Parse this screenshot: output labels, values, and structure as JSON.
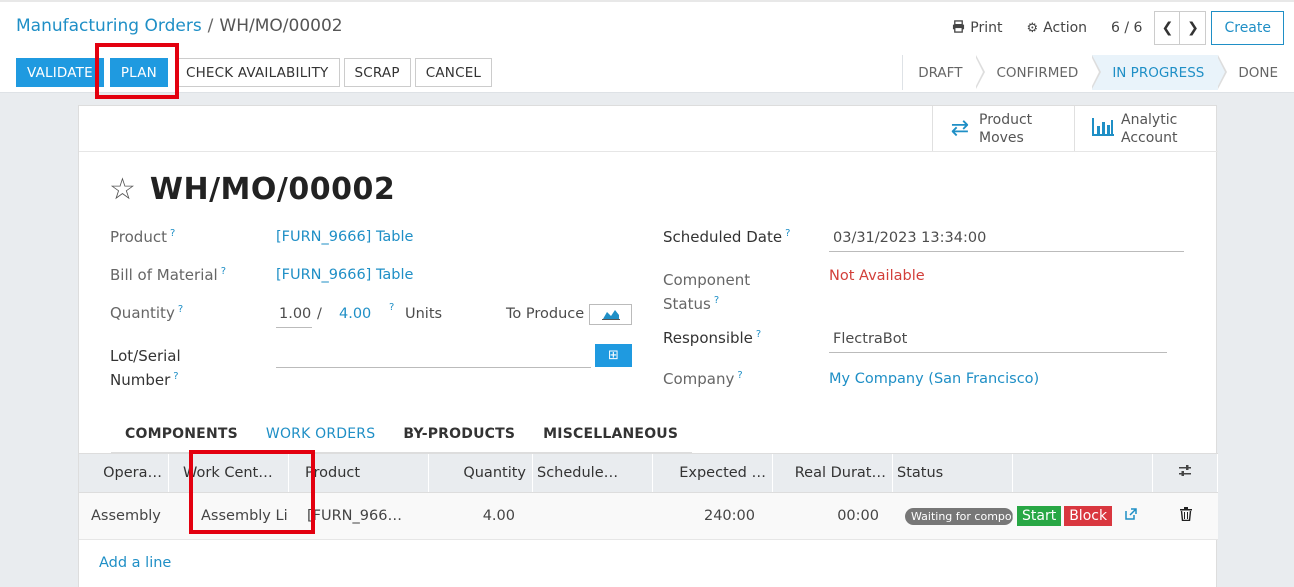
{
  "breadcrumb": {
    "parent": "Manufacturing Orders",
    "separator": "/",
    "current": "WH/MO/00002"
  },
  "pager": {
    "print_label": "Print",
    "action_label": "Action",
    "count": "6 / 6",
    "create_label": "Create"
  },
  "actions": {
    "validate": "VALIDATE",
    "plan": "PLAN",
    "check_availability": "CHECK AVAILABILITY",
    "scrap": "SCRAP",
    "cancel": "CANCEL"
  },
  "statusbar": [
    "DRAFT",
    "CONFIRMED",
    "IN PROGRESS",
    "DONE"
  ],
  "statusbar_active": "IN PROGRESS",
  "smart_buttons": {
    "product_moves": {
      "line1": "Product",
      "line2": "Moves"
    },
    "analytic_account": {
      "line1": "Analytic",
      "line2": "Account"
    }
  },
  "record": {
    "title": "WH/MO/00002",
    "product_label": "Product",
    "product_value": "[FURN_9666] Table",
    "bom_label": "Bill of Material",
    "bom_value": "[FURN_9666] Table",
    "quantity_label": "Quantity",
    "qty_produced": "1.00",
    "qty_sep": "/",
    "qty_total": "4.00",
    "qty_unit": "Units",
    "to_produce_label": "To Produce",
    "lot_label_1": "Lot/Serial",
    "lot_label_2": "Number",
    "scheduled_date_label": "Scheduled Date",
    "scheduled_date_value": "03/31/2023 13:34:00",
    "component_status_label_1": "Component",
    "component_status_label_2": "Status",
    "component_status_value": "Not Available",
    "responsible_label": "Responsible",
    "responsible_value": "FlectraBot",
    "company_label": "Company",
    "company_value": "My Company (San Francisco)",
    "help_mark": "?"
  },
  "tabs": [
    "COMPONENTS",
    "WORK ORDERS",
    "BY-PRODUCTS",
    "MISCELLANEOUS"
  ],
  "active_tab": "WORK ORDERS",
  "work_orders": {
    "columns": [
      "Opera…",
      "Work Cent…",
      "Product",
      "Quantity",
      "Schedule…",
      "Expected …",
      "Real Durat…",
      "Status"
    ],
    "rows": [
      {
        "operation": "Assembly",
        "work_center": "Assembly Li…",
        "product": "[FURN_966…",
        "quantity": "4.00",
        "scheduled": "",
        "expected": "240:00",
        "real": "00:00",
        "status": "Waiting for components",
        "start": "Start",
        "block": "Block"
      }
    ],
    "add_line": "Add a line"
  },
  "colors": {
    "accent": "#1f9ae0",
    "link": "#1f8fc6",
    "highlight": "#e3000f",
    "start": "#28a745",
    "block": "#d9373f"
  }
}
